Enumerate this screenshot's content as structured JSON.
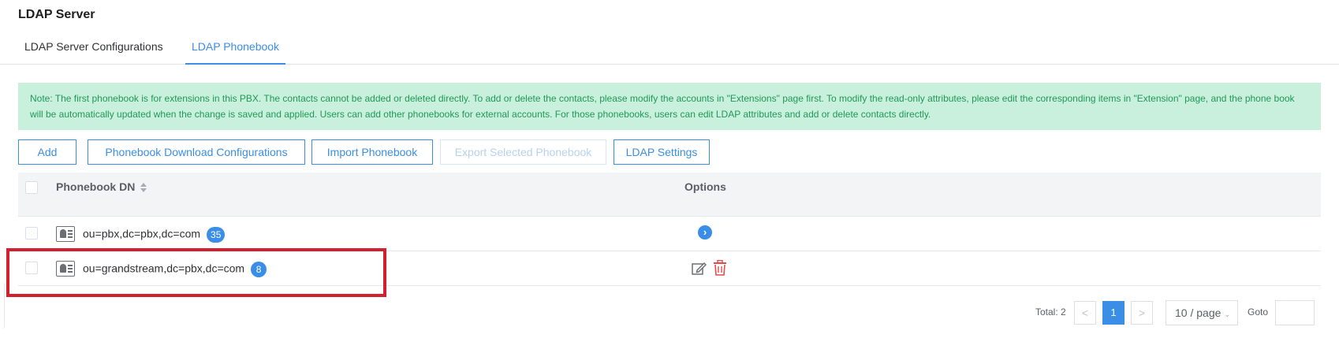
{
  "page": {
    "title": "LDAP Server"
  },
  "tabs": [
    {
      "label": "LDAP Server Configurations",
      "active": false
    },
    {
      "label": "LDAP Phonebook",
      "active": true
    }
  ],
  "note": "Note: The first phonebook is for extensions in this PBX. The contacts cannot be added or deleted directly. To add or delete the contacts, please modify the accounts in \"Extensions\" page first. To modify the read-only attributes, please edit the corresponding items in \"Extension\" page, and the phone book will be automatically updated when the change is saved and applied. Users can add other phonebooks for external accounts. For those phonebooks, users can edit LDAP attributes and add or delete contacts directly.",
  "toolbar": {
    "add": "Add",
    "download": "Phonebook Download Configurations",
    "import": "Import Phonebook",
    "export": "Export Selected Phonebook",
    "settings": "LDAP Settings"
  },
  "table": {
    "headers": {
      "dn": "Phonebook DN",
      "options": "Options"
    },
    "rows": [
      {
        "dn": "ou=pbx,dc=pbx,dc=com",
        "count": "35",
        "option": "chevron-right"
      },
      {
        "dn": "ou=grandstream,dc=pbx,dc=com",
        "count": "8",
        "option": "edit-delete"
      }
    ]
  },
  "pagination": {
    "total": "Total: 2",
    "prev": "<",
    "current": "1",
    "next": ">",
    "page_size": "10 / page",
    "goto": "Goto"
  },
  "colors": {
    "accent": "#3a8ee6",
    "note_bg": "#c9efdd",
    "note_text": "#1f9a55",
    "danger": "#e24b4b",
    "highlight": "#d3202f"
  }
}
